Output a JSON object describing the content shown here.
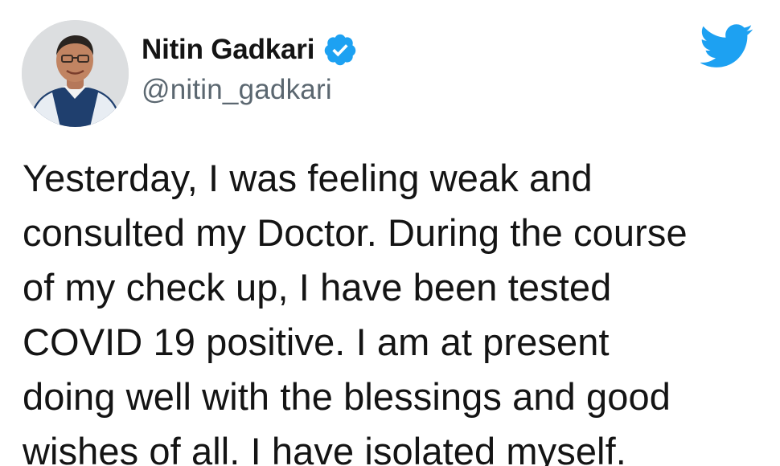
{
  "author": {
    "display_name": "Nitin Gadkari",
    "handle": "@nitin_gadkari",
    "verified": true
  },
  "tweet": {
    "lines": [
      "Yesterday, I was feeling weak and",
      "consulted my Doctor. During the course",
      "of my check up, I have been tested",
      "COVID 19 positive. I am at present",
      "doing well with the blessings and good",
      "wishes of all. I have isolated myself."
    ]
  },
  "colors": {
    "brand": "#1da1f2",
    "text": "#141414",
    "secondary_text": "#5b6770"
  },
  "icons": {
    "verified": "verified-badge-icon",
    "brand": "twitter-bird-icon"
  }
}
